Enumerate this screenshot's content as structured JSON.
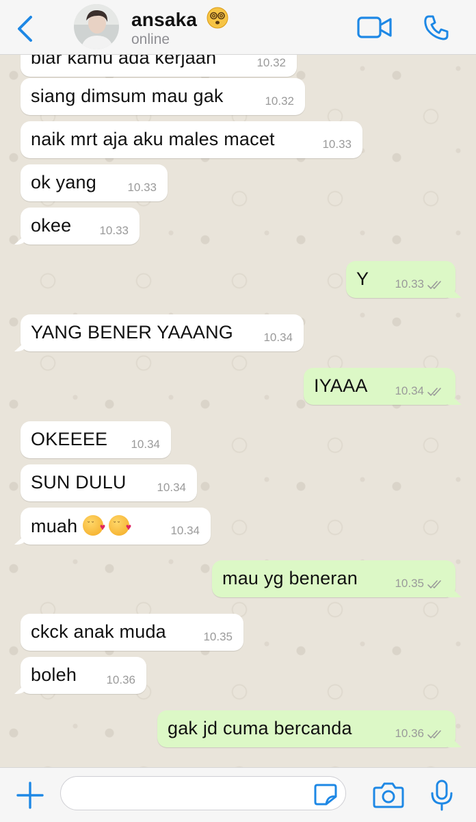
{
  "header": {
    "contact_name": "ansaka",
    "status": "online",
    "accent": "#1e88e5"
  },
  "messages": [
    {
      "dir": "in",
      "text": "biar kamu ada kerjaan",
      "time": "10.32"
    },
    {
      "dir": "in",
      "text": "siang dimsum mau gak",
      "time": "10.32"
    },
    {
      "dir": "in",
      "text": "naik mrt aja aku males macet",
      "time": "10.33"
    },
    {
      "dir": "in",
      "text": "ok yang",
      "time": "10.33"
    },
    {
      "dir": "in",
      "text": "okee",
      "time": "10.33"
    },
    {
      "dir": "out",
      "text": "Y",
      "time": "10.33",
      "read": true
    },
    {
      "dir": "in",
      "text": "YANG BENER YAAANG",
      "time": "10.34"
    },
    {
      "dir": "out",
      "text": "IYAAA",
      "time": "10.34",
      "read": true
    },
    {
      "dir": "in",
      "text": "OKEEEE",
      "time": "10.34"
    },
    {
      "dir": "in",
      "text": "SUN DULU",
      "time": "10.34"
    },
    {
      "dir": "in",
      "text": "muah",
      "emoji": [
        "kissing-heart-emoji",
        "kissing-heart-emoji"
      ],
      "time": "10.34"
    },
    {
      "dir": "out",
      "text": "mau yg beneran",
      "time": "10.35",
      "read": true
    },
    {
      "dir": "in",
      "text": "ckck anak muda",
      "time": "10.35"
    },
    {
      "dir": "in",
      "text": "boleh",
      "time": "10.36"
    },
    {
      "dir": "out",
      "text": "gak jd cuma bercanda",
      "time": "10.36",
      "read": true
    }
  ],
  "composer": {
    "value": "",
    "icons": [
      "plus-icon",
      "sticker-icon",
      "camera-icon",
      "microphone-icon"
    ]
  },
  "colors": {
    "incoming_bubble": "#ffffff",
    "outgoing_bubble": "#dcf8c6",
    "chat_background": "#e9e4da",
    "icon_blue": "#1e88e5"
  }
}
